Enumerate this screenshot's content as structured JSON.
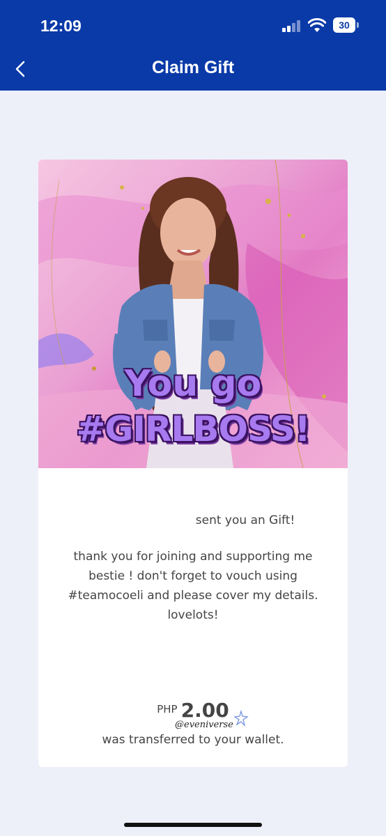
{
  "status_bar": {
    "time": "12:09",
    "battery": "30",
    "icons": [
      "cellular-signal-icon",
      "wifi-icon",
      "battery-icon"
    ]
  },
  "header": {
    "title": "Claim Gift",
    "back_icon": "chevron-left-icon",
    "background_color": "#0a3aa8"
  },
  "gift_card": {
    "banner": {
      "line1": "You go",
      "line2": "#GIRLBOSS!",
      "image": "woman-in-denim-jacket-photo"
    },
    "sender_text": "sent you an Gift!",
    "message": "thank you for joining and supporting me bestie ! don't forget to vouch using #teamocoeli and please cover my details. lovelots!",
    "currency": "PHP",
    "amount": "2.00",
    "watermark": "@eveniverse",
    "transfer_text": "was transferred to your wallet."
  },
  "colors": {
    "page_background": "#eef0f9",
    "text": "#444444",
    "headline": "#a77af0"
  }
}
